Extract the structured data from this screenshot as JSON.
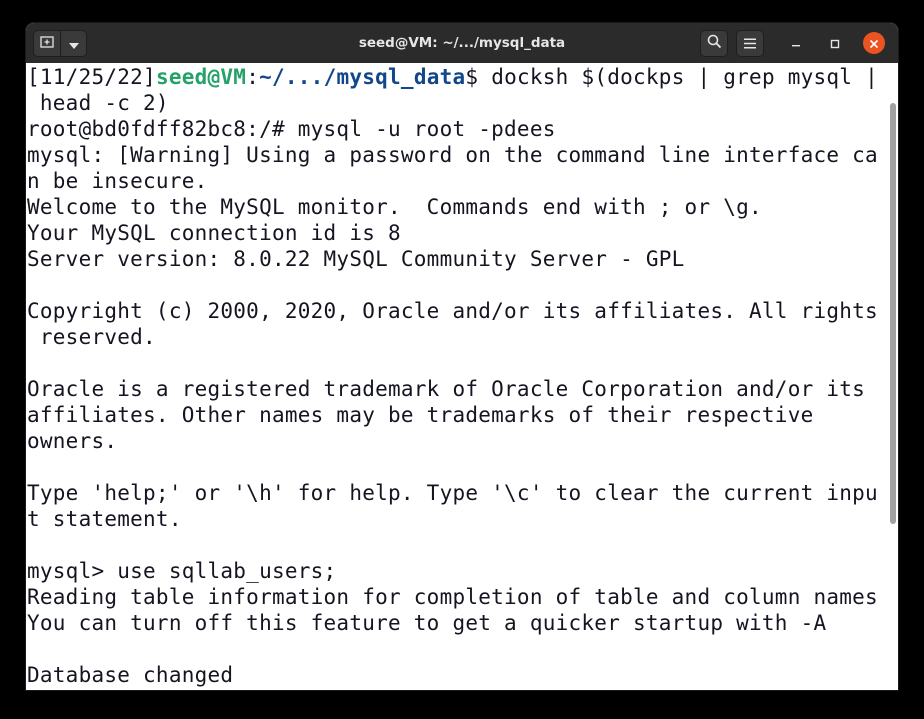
{
  "window": {
    "title": "seed@VM: ~/.../mysql_data"
  },
  "titlebar": {
    "icons": {
      "new_tab": "new-tab-icon",
      "tab_menu": "chevron-down-icon",
      "search": "search-icon",
      "menu": "hamburger-menu-icon",
      "minimize": "minimize-icon",
      "maximize": "maximize-icon",
      "close": "close-icon"
    }
  },
  "colors": {
    "prompt_user": "#26a269",
    "prompt_path": "#12488b",
    "close_button": "#e95420",
    "terminal_bg": "#ffffff",
    "terminal_fg": "#171421"
  },
  "terminal": {
    "prompt": {
      "timestamp": "[11/25/22]",
      "user_host": "seed@VM",
      "separator": ":",
      "path": "~/.../mysql_data",
      "command": "$ docksh $(dockps | grep mysql |\n head -c 2)"
    },
    "body": "root@bd0fdff82bc8:/# mysql -u root -pdees\nmysql: [Warning] Using a password on the command line interface ca\nn be insecure.\nWelcome to the MySQL monitor.  Commands end with ; or \\g.\nYour MySQL connection id is 8\nServer version: 8.0.22 MySQL Community Server - GPL\n\nCopyright (c) 2000, 2020, Oracle and/or its affiliates. All rights\n reserved.\n\nOracle is a registered trademark of Oracle Corporation and/or its\naffiliates. Other names may be trademarks of their respective\nowners.\n\nType 'help;' or '\\h' for help. Type '\\c' to clear the current inpu\nt statement.\n\nmysql> use sqllab_users;\nReading table information for completion of table and column names\nYou can turn off this feature to get a quicker startup with -A\n\nDatabase changed"
  }
}
